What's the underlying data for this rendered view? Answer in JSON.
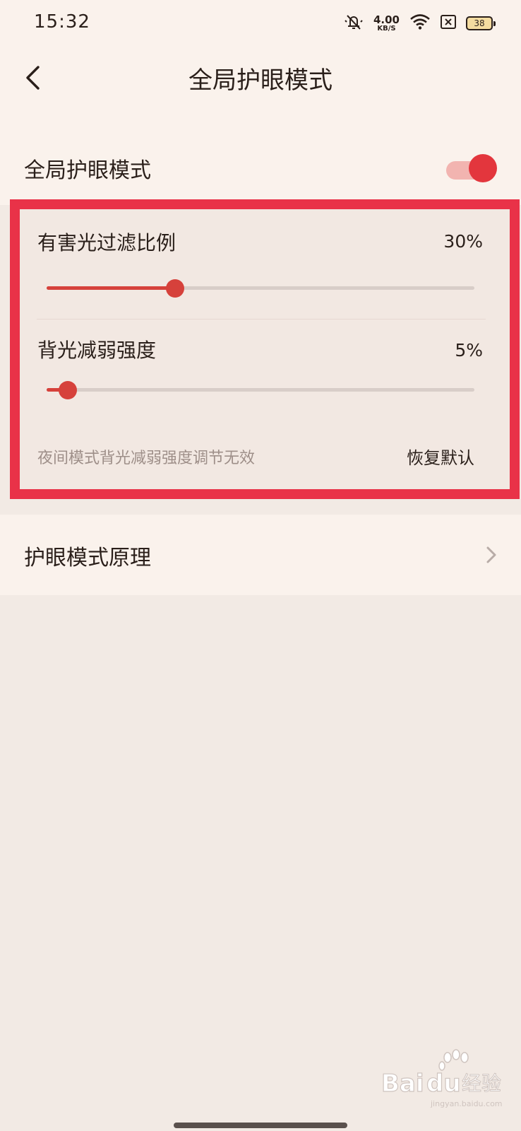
{
  "status_bar": {
    "time": "15:32",
    "net_speed_value": "4.00",
    "net_speed_unit": "KB/S",
    "battery_level": "38",
    "icons": [
      "mute-bell-icon",
      "wifi-icon",
      "sim-off-icon",
      "battery-icon"
    ]
  },
  "header": {
    "title": "全局护眼模式",
    "back_icon": "chevron-left-icon"
  },
  "eye_care": {
    "label": "全局护眼模式",
    "enabled": true,
    "accent_color": "#e3363d"
  },
  "sliders": [
    {
      "label": "有害光过滤比例",
      "value_text": "30%",
      "value": 0.3
    },
    {
      "label": "背光减弱强度",
      "value_text": "5%",
      "value": 0.05
    }
  ],
  "note": "夜间模式背光减弱强度调节无效",
  "reset_label": "恢复默认",
  "principle": {
    "label": "护眼模式原理",
    "icon": "chevron-right-icon"
  },
  "watermark": {
    "text": "Baidu经验",
    "sub": "jingyan.baidu.com"
  }
}
